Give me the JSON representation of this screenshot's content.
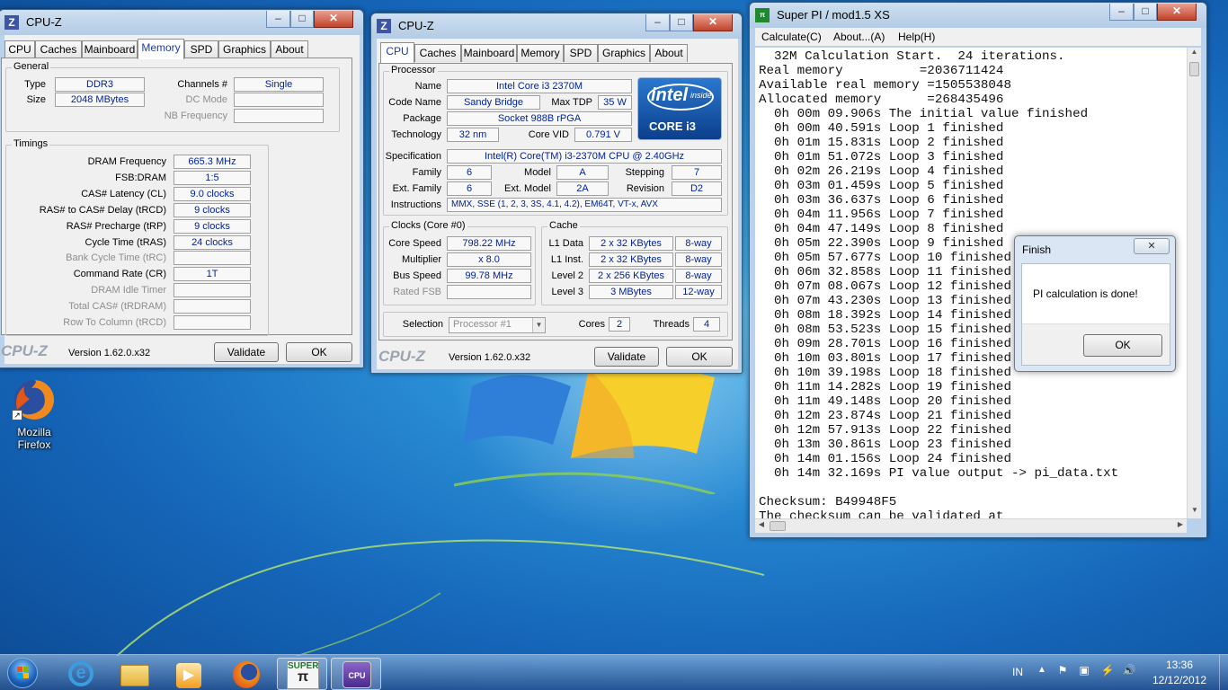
{
  "desktop": {
    "icons": [
      {
        "label_line1": "Mozilla",
        "label_line2": "Firefox",
        "icon": "firefox-icon"
      }
    ]
  },
  "cpuz_memory": {
    "title": "CPU-Z",
    "tabs": [
      "CPU",
      "Caches",
      "Mainboard",
      "Memory",
      "SPD",
      "Graphics",
      "About"
    ],
    "active_tab": "Memory",
    "general_title": "General",
    "type_label": "Type",
    "type_value": "DDR3",
    "size_label": "Size",
    "size_value": "2048 MBytes",
    "channels_label": "Channels #",
    "channels_value": "Single",
    "dcmode_label": "DC Mode",
    "dcmode_value": "",
    "nbfreq_label": "NB Frequency",
    "nbfreq_value": "",
    "timings_title": "Timings",
    "timings": [
      {
        "label": "DRAM Frequency",
        "value": "665.3 MHz",
        "dim": false
      },
      {
        "label": "FSB:DRAM",
        "value": "1:5",
        "dim": false
      },
      {
        "label": "CAS# Latency (CL)",
        "value": "9.0 clocks",
        "dim": false
      },
      {
        "label": "RAS# to CAS# Delay (tRCD)",
        "value": "9 clocks",
        "dim": false
      },
      {
        "label": "RAS# Precharge (tRP)",
        "value": "9 clocks",
        "dim": false
      },
      {
        "label": "Cycle Time (tRAS)",
        "value": "24 clocks",
        "dim": false
      },
      {
        "label": "Bank Cycle Time (tRC)",
        "value": "",
        "dim": true
      },
      {
        "label": "Command Rate (CR)",
        "value": "1T",
        "dim": false
      },
      {
        "label": "DRAM Idle Timer",
        "value": "",
        "dim": true
      },
      {
        "label": "Total CAS# (tRDRAM)",
        "value": "",
        "dim": true
      },
      {
        "label": "Row To Column (tRCD)",
        "value": "",
        "dim": true
      }
    ],
    "logo": "CPU-Z",
    "version": "Version 1.62.0.x32",
    "validate_label": "Validate",
    "ok_label": "OK"
  },
  "cpuz_cpu": {
    "title": "CPU-Z",
    "tabs": [
      "CPU",
      "Caches",
      "Mainboard",
      "Memory",
      "SPD",
      "Graphics",
      "About"
    ],
    "active_tab": "CPU",
    "processor_title": "Processor",
    "name_label": "Name",
    "name_value": "Intel Core i3 2370M",
    "codename_label": "Code Name",
    "codename_value": "Sandy Bridge",
    "maxtdp_label": "Max TDP",
    "maxtdp_value": "35 W",
    "package_label": "Package",
    "package_value": "Socket 988B rPGA",
    "technology_label": "Technology",
    "technology_value": "32 nm",
    "corevid_label": "Core VID",
    "corevid_value": "0.791 V",
    "spec_label": "Specification",
    "spec_value": "Intel(R) Core(TM) i3-2370M CPU @ 2.40GHz",
    "family_label": "Family",
    "family_value": "6",
    "model_label": "Model",
    "model_value": "A",
    "stepping_label": "Stepping",
    "stepping_value": "7",
    "extfamily_label": "Ext. Family",
    "extfamily_value": "6",
    "extmodel_label": "Ext. Model",
    "extmodel_value": "2A",
    "revision_label": "Revision",
    "revision_value": "D2",
    "instructions_label": "Instructions",
    "instructions_value": "MMX, SSE (1, 2, 3, 3S, 4.1, 4.2), EM64T, VT-x, AVX",
    "intel_brand": "intel",
    "intel_inside": "inside",
    "intel_core": "CORE i3",
    "clocks_title": "Clocks (Core #0)",
    "corespeed_label": "Core Speed",
    "corespeed_value": "798.22 MHz",
    "multiplier_label": "Multiplier",
    "multiplier_value": "x 8.0",
    "busspeed_label": "Bus Speed",
    "busspeed_value": "99.78 MHz",
    "ratedfsb_label": "Rated FSB",
    "ratedfsb_value": "",
    "cache_title": "Cache",
    "l1data_label": "L1 Data",
    "l1data_value": "2 x 32 KBytes",
    "l1data_way": "8-way",
    "l1inst_label": "L1 Inst.",
    "l1inst_value": "2 x 32 KBytes",
    "l1inst_way": "8-way",
    "level2_label": "Level 2",
    "level2_value": "2 x 256 KBytes",
    "level2_way": "8-way",
    "level3_label": "Level 3",
    "level3_value": "3 MBytes",
    "level3_way": "12-way",
    "selection_label": "Selection",
    "selection_value": "Processor #1",
    "cores_label": "Cores",
    "cores_value": "2",
    "threads_label": "Threads",
    "threads_value": "4",
    "logo": "CPU-Z",
    "version": "Version 1.62.0.x32",
    "validate_label": "Validate",
    "ok_label": "OK"
  },
  "superpi": {
    "title": "Super PI / mod1.5 XS",
    "menu": [
      "Calculate(C)",
      "About...(A)",
      "Help(H)"
    ],
    "lines": [
      "  32M Calculation Start.  24 iterations.",
      "Real memory          =2036711424",
      "Available real memory =1505538048",
      "Allocated memory      =268435496",
      "  0h 00m 09.906s The initial value finished",
      "  0h 00m 40.591s Loop 1 finished",
      "  0h 01m 15.831s Loop 2 finished",
      "  0h 01m 51.072s Loop 3 finished",
      "  0h 02m 26.219s Loop 4 finished",
      "  0h 03m 01.459s Loop 5 finished",
      "  0h 03m 36.637s Loop 6 finished",
      "  0h 04m 11.956s Loop 7 finished",
      "  0h 04m 47.149s Loop 8 finished",
      "  0h 05m 22.390s Loop 9 finished",
      "  0h 05m 57.677s Loop 10 finished",
      "  0h 06m 32.858s Loop 11 finished",
      "  0h 07m 08.067s Loop 12 finished",
      "  0h 07m 43.230s Loop 13 finished",
      "  0h 08m 18.392s Loop 14 finished",
      "  0h 08m 53.523s Loop 15 finished",
      "  0h 09m 28.701s Loop 16 finished",
      "  0h 10m 03.801s Loop 17 finished",
      "  0h 10m 39.198s Loop 18 finished",
      "  0h 11m 14.282s Loop 19 finished",
      "  0h 11m 49.148s Loop 20 finished",
      "  0h 12m 23.874s Loop 21 finished",
      "  0h 12m 57.913s Loop 22 finished",
      "  0h 13m 30.861s Loop 23 finished",
      "  0h 14m 01.156s Loop 24 finished",
      "  0h 14m 32.169s PI value output -> pi_data.txt",
      "",
      "Checksum: B49948F5",
      "The checksum can be validated at"
    ]
  },
  "finish_dialog": {
    "title": "Finish",
    "message": "PI calculation is done!",
    "ok_label": "OK"
  },
  "taskbar": {
    "items": [
      "windows-start-icon",
      "internet-explorer-icon",
      "file-explorer-icon",
      "media-player-icon",
      "firefox-icon",
      "superpi-icon",
      "cpuz-icon"
    ],
    "language": "IN",
    "time": "13:36",
    "date": "12/12/2012"
  }
}
